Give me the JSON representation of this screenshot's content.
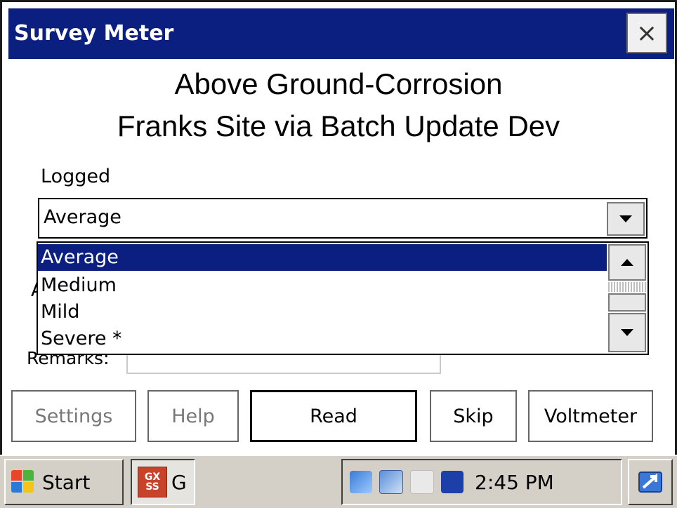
{
  "window": {
    "title": "Survey Meter",
    "close_glyph": "×"
  },
  "heading": {
    "line1": "Above Ground-Corrosion",
    "line2": "Franks Site via Batch Update Dev"
  },
  "logged": {
    "label": "Logged",
    "selected": "Average",
    "options": [
      "Average",
      "Medium",
      "Mild",
      "Severe *"
    ]
  },
  "remarks": {
    "label": "Remarks:",
    "value": ""
  },
  "buttons": {
    "settings": "Settings",
    "help": "Help",
    "read": "Read",
    "skip": "Skip",
    "voltmeter": "Voltmeter"
  },
  "taskbar": {
    "start_label": "Start",
    "task_icon_text": "GX SS",
    "task_label": "G",
    "clock": "2:45 PM",
    "tray_icons": [
      "network-icon",
      "sync-icon",
      "bluetooth-icon",
      "otg-icon"
    ]
  },
  "colors": {
    "titlebar": "#0a1f7f",
    "selection": "#0a1f7f"
  }
}
